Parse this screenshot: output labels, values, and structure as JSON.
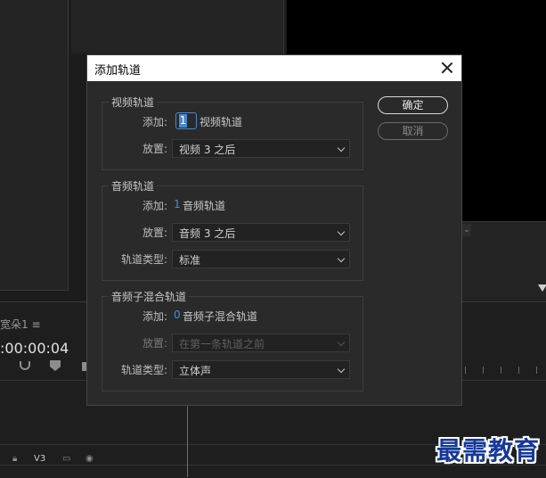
{
  "background": {
    "sequence_tab": "宽朵1 ≡",
    "timecode": ":00:00:04",
    "track_label": "V3",
    "watermark": "最需教育"
  },
  "dialog": {
    "title": "添加轨道",
    "ok_label": "确定",
    "cancel_label": "取消",
    "video": {
      "group_title": "视频轨道",
      "add_label": "添加:",
      "add_value": "1",
      "add_unit": "视频轨道",
      "placement_label": "放置:",
      "placement_value": "视频 3 之后"
    },
    "audio": {
      "group_title": "音频轨道",
      "add_label": "添加:",
      "add_value": "1",
      "add_unit": "音频轨道",
      "placement_label": "放置:",
      "placement_value": "音频 3 之后",
      "type_label": "轨道类型:",
      "type_value": "标准"
    },
    "submix": {
      "group_title": "音频子混合轨道",
      "add_label": "添加:",
      "add_value": "0",
      "add_unit": "音频子混合轨道",
      "placement_label": "放置:",
      "placement_value": "在第一条轨道之前",
      "type_label": "轨道类型:",
      "type_value": "立体声"
    }
  },
  "colors": {
    "accent_blue": "#3f8fe0",
    "dialog_bg": "#2a2a2a",
    "watermark": "#17389a"
  }
}
